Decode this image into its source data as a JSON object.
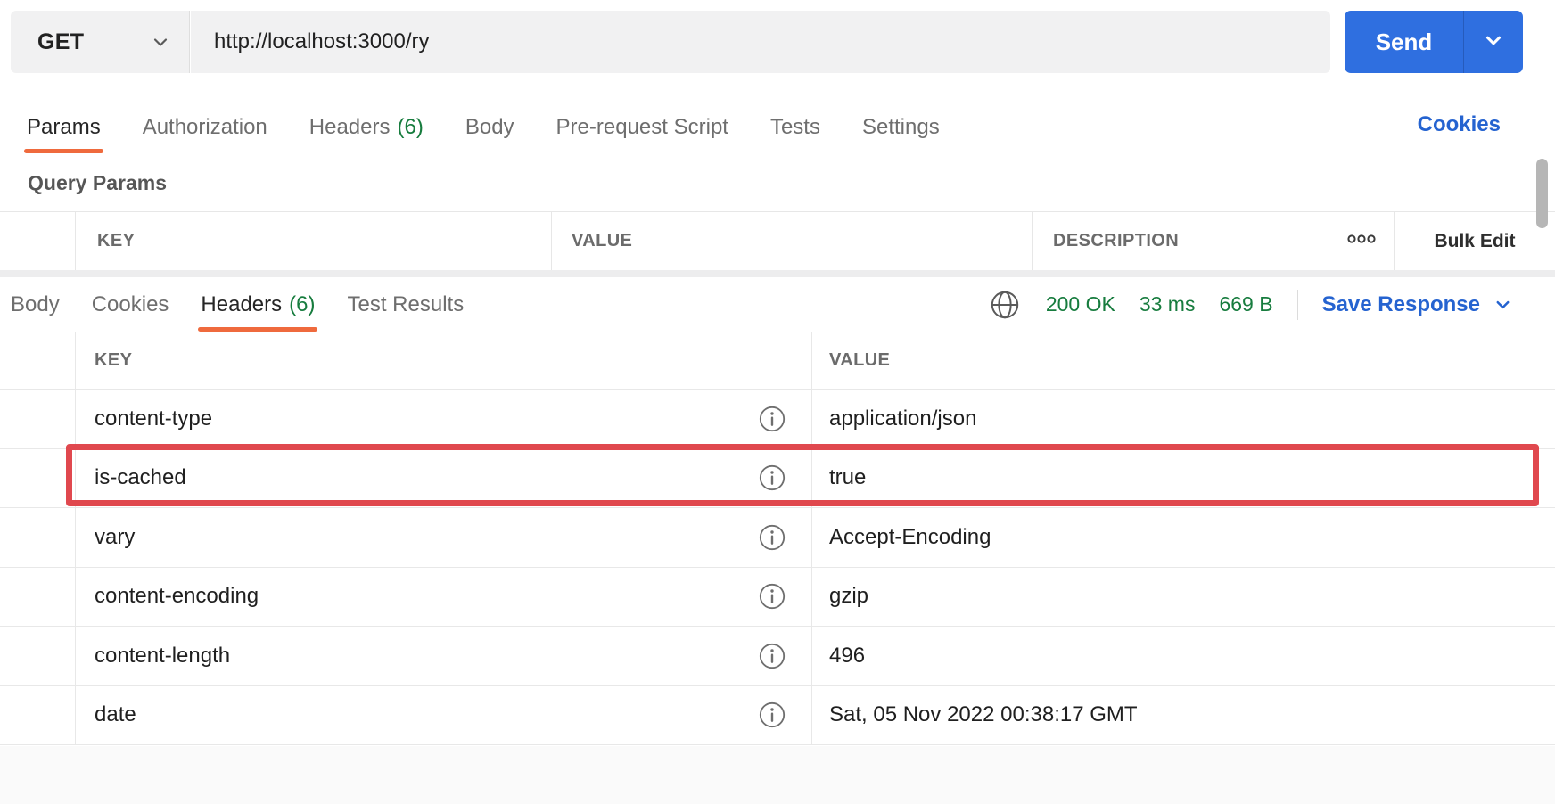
{
  "request": {
    "method": "GET",
    "url": "http://localhost:3000/ry",
    "send_label": "Send",
    "tabs": [
      {
        "label": "Params",
        "active": true
      },
      {
        "label": "Authorization",
        "active": false
      },
      {
        "label": "Headers",
        "count": "(6)",
        "active": false
      },
      {
        "label": "Body",
        "active": false
      },
      {
        "label": "Pre-request Script",
        "active": false
      },
      {
        "label": "Tests",
        "active": false
      },
      {
        "label": "Settings",
        "active": false
      }
    ],
    "cookies_link": "Cookies",
    "query_params": {
      "title": "Query Params",
      "columns": [
        "KEY",
        "VALUE",
        "DESCRIPTION"
      ],
      "bulk_edit_label": "Bulk Edit"
    }
  },
  "response": {
    "tabs": [
      {
        "label": "Body",
        "active": false
      },
      {
        "label": "Cookies",
        "active": false
      },
      {
        "label": "Headers",
        "count": "(6)",
        "active": true
      },
      {
        "label": "Test Results",
        "active": false
      }
    ],
    "status": {
      "code": "200 OK",
      "time": "33 ms",
      "size": "669 B"
    },
    "save_response_label": "Save Response",
    "headers_table": {
      "columns": [
        "KEY",
        "VALUE"
      ],
      "rows": [
        {
          "key": "content-type",
          "value": "application/json",
          "highlighted": false
        },
        {
          "key": "is-cached",
          "value": "true",
          "highlighted": true
        },
        {
          "key": "vary",
          "value": "Accept-Encoding",
          "highlighted": false
        },
        {
          "key": "content-encoding",
          "value": "gzip",
          "highlighted": false
        },
        {
          "key": "content-length",
          "value": "496",
          "highlighted": false
        },
        {
          "key": "date",
          "value": "Sat, 05 Nov 2022 00:38:17 GMT",
          "highlighted": false
        }
      ]
    }
  },
  "icons": {
    "method_caret": "chevron-down",
    "send_caret": "chevron-down",
    "network": "globe",
    "row_info": "info-circle",
    "more_options": "three-circles",
    "save_caret": "chevron-down"
  },
  "colors": {
    "accent_orange": "#ef6a3d",
    "success_green": "#177c3e",
    "send_button_blue": "#2f6fe0",
    "link_blue": "#2563d0",
    "highlight_red": "#e0484e",
    "field_gray": "#f1f1f2"
  }
}
